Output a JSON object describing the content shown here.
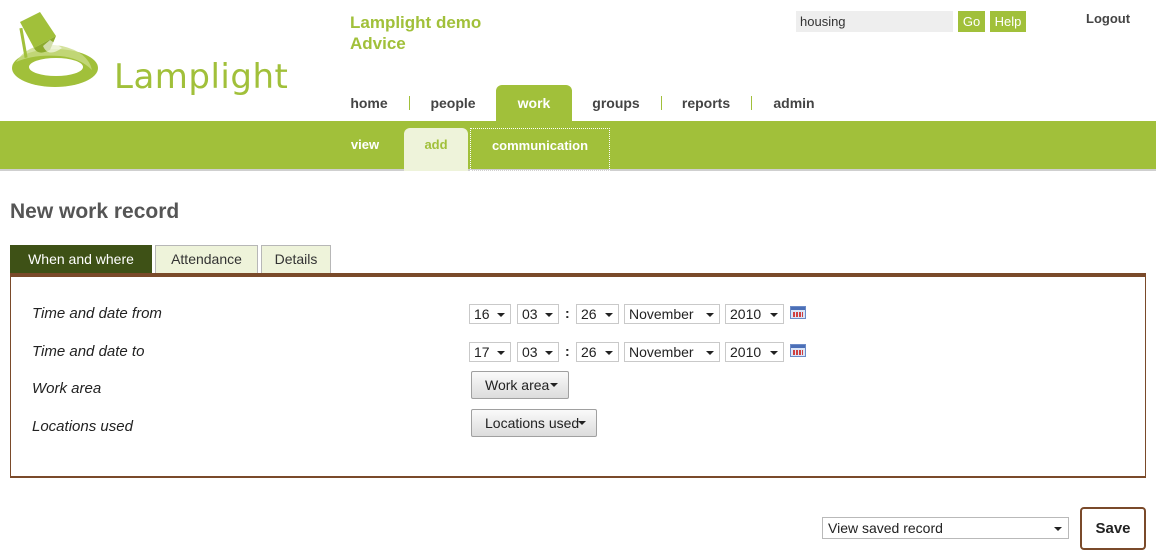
{
  "brand": {
    "name": "Lamplight",
    "org_line1": "Lamplight demo",
    "org_line2": "Advice",
    "color": "#a1c03a"
  },
  "header": {
    "search_value": "housing",
    "go_label": "Go",
    "help_label": "Help",
    "logout_label": "Logout"
  },
  "nav": {
    "items": [
      {
        "label": "home"
      },
      {
        "label": "people"
      },
      {
        "label": "work"
      },
      {
        "label": "groups"
      },
      {
        "label": "reports"
      },
      {
        "label": "admin"
      }
    ],
    "active": "work"
  },
  "subnav": {
    "items": [
      {
        "label": "view"
      },
      {
        "label": "add"
      },
      {
        "label": "communication"
      }
    ],
    "active": "add"
  },
  "page": {
    "title": "New work record"
  },
  "tabs": {
    "items": [
      {
        "label": "When and where"
      },
      {
        "label": "Attendance"
      },
      {
        "label": "Details"
      }
    ],
    "active": "When and where"
  },
  "form": {
    "from": {
      "label": "Time and date from",
      "hour": "16",
      "minute": "03",
      "day": "26",
      "month": "November",
      "year": "2010"
    },
    "to": {
      "label": "Time and date to",
      "hour": "17",
      "minute": "03",
      "day": "26",
      "month": "November",
      "year": "2010"
    },
    "work_area": {
      "label": "Work area",
      "button": "Work area"
    },
    "locations": {
      "label": "Locations used",
      "button": "Locations used"
    },
    "time_separator": ":"
  },
  "footer": {
    "view_select": "View saved record",
    "save_label": "Save"
  },
  "icons": {
    "logo": "lamp-logo-icon",
    "calendar": "calendar-icon",
    "dropdown": "chevron-down-icon"
  },
  "colors": {
    "accent": "#a1c03a",
    "active_tab": "#3e5116",
    "panel_border": "#7a4a2a",
    "tab_bg": "#eef3da"
  }
}
